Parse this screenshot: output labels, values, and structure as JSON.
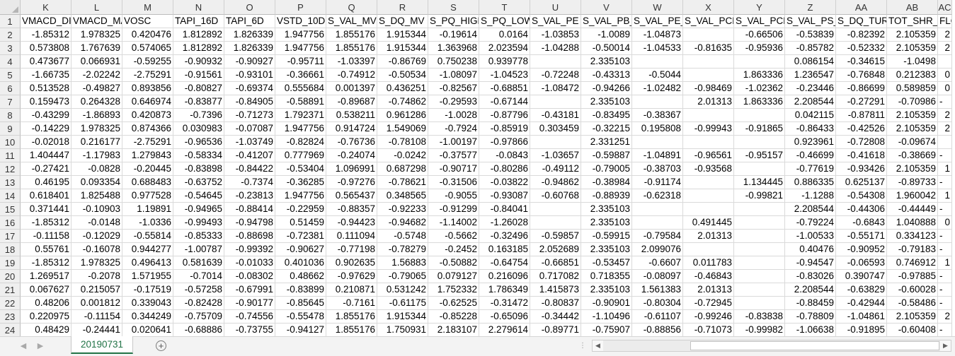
{
  "spreadsheet": {
    "column_letters": [
      "K",
      "L",
      "M",
      "N",
      "O",
      "P",
      "Q",
      "R",
      "S",
      "T",
      "U",
      "V",
      "W",
      "X",
      "Y",
      "Z",
      "AA",
      "AB",
      "AC"
    ],
    "row_numbers": [
      "1",
      "2",
      "3",
      "4",
      "5",
      "6",
      "7",
      "8",
      "9",
      "10",
      "11",
      "12",
      "13",
      "14",
      "15",
      "16",
      "17",
      "18",
      "19",
      "20",
      "21",
      "22",
      "23",
      "24"
    ],
    "rows": [
      [
        "VMACD_DIF",
        "VMACD_MACD",
        "VOSC",
        "TAPI_16D",
        "TAPI_6D",
        "VSTD_10D",
        "S_VAL_MV",
        "S_DQ_MV",
        "S_PQ_HIGH",
        "S_PQ_LOW",
        "S_VAL_PE",
        "S_VAL_PB_",
        "S_VAL_PE_",
        "S_VAL_PCF",
        "S_VAL_PCF",
        "S_VAL_PS_",
        "S_DQ_TUR",
        "TOT_SHR_T",
        "FLOAT"
      ],
      [
        "-1.85312",
        "1.978325",
        "0.420476",
        "1.812892",
        "1.826339",
        "1.947756",
        "1.855176",
        "1.915344",
        "-0.19614",
        "0.0164",
        "-1.03853",
        "-1.0089",
        "-1.04873",
        "",
        "-0.66506",
        "-0.53839",
        "-0.82392",
        "2.105359",
        "2"
      ],
      [
        "0.573808",
        "1.767639",
        "0.574065",
        "1.812892",
        "1.826339",
        "1.947756",
        "1.855176",
        "1.915344",
        "1.363968",
        "2.023594",
        "-1.04288",
        "-0.50014",
        "-1.04533",
        "-0.81635",
        "-0.95936",
        "-0.85782",
        "-0.52332",
        "2.105359",
        "2"
      ],
      [
        "0.473677",
        "0.066931",
        "-0.59255",
        "-0.90932",
        "-0.90927",
        "-0.95711",
        "-1.03397",
        "-0.86769",
        "0.750238",
        "0.939778",
        "",
        "2.335103",
        "",
        "",
        "",
        "0.086154",
        "-0.34615",
        "-1.0498",
        ""
      ],
      [
        "-1.66735",
        "-2.02242",
        "-2.75291",
        "-0.91561",
        "-0.93101",
        "-0.36661",
        "-0.74912",
        "-0.50534",
        "-1.08097",
        "-1.04523",
        "-0.72248",
        "-0.43313",
        "-0.5044",
        "",
        "1.863336",
        "1.236547",
        "-0.76848",
        "0.212383",
        "0"
      ],
      [
        "0.513528",
        "-0.49827",
        "0.893856",
        "-0.80827",
        "-0.69374",
        "0.555684",
        "0.001397",
        "0.436251",
        "-0.82567",
        "-0.68851",
        "-1.08472",
        "-0.94266",
        "-1.02482",
        "-0.98469",
        "-1.02362",
        "-0.23446",
        "-0.86699",
        "0.589859",
        "0"
      ],
      [
        "0.159473",
        "0.264328",
        "0.646974",
        "-0.83877",
        "-0.84905",
        "-0.58891",
        "-0.89687",
        "-0.74862",
        "-0.29593",
        "-0.67144",
        "",
        "2.335103",
        "",
        "2.01313",
        "1.863336",
        "2.208544",
        "-0.27291",
        "-0.70986",
        "-"
      ],
      [
        "-0.43299",
        "-1.86893",
        "0.420873",
        "-0.7396",
        "-0.71273",
        "1.792371",
        "0.538211",
        "0.961286",
        "-1.0028",
        "-0.87796",
        "-0.43181",
        "-0.83495",
        "-0.38367",
        "",
        "",
        "0.042115",
        "-0.87811",
        "2.105359",
        "2"
      ],
      [
        "-0.14229",
        "1.978325",
        "0.874366",
        "0.030983",
        "-0.07087",
        "1.947756",
        "0.914724",
        "1.549069",
        "-0.7924",
        "-0.85919",
        "0.303459",
        "-0.32215",
        "0.195808",
        "-0.99943",
        "-0.91865",
        "-0.86433",
        "-0.42526",
        "2.105359",
        "2"
      ],
      [
        "-0.02018",
        "0.216177",
        "-2.75291",
        "-0.96536",
        "-1.03749",
        "-0.82824",
        "-0.76736",
        "-0.78108",
        "-1.00197",
        "-0.97866",
        "",
        "2.331251",
        "",
        "",
        "",
        "0.923961",
        "-0.72808",
        "-0.09674",
        ""
      ],
      [
        "1.404447",
        "-1.17983",
        "1.279843",
        "-0.58334",
        "-0.41207",
        "0.777969",
        "-0.24074",
        "-0.0242",
        "-0.37577",
        "-0.0843",
        "-1.03657",
        "-0.59887",
        "-1.04891",
        "-0.96561",
        "-0.95157",
        "-0.46699",
        "-0.41618",
        "-0.38669",
        "-"
      ],
      [
        "-0.27421",
        "-0.0828",
        "-0.20445",
        "-0.83898",
        "-0.84422",
        "-0.53404",
        "1.096991",
        "0.687298",
        "-0.90717",
        "-0.80286",
        "-0.49112",
        "-0.79005",
        "-0.38703",
        "-0.93568",
        "",
        "-0.77619",
        "-0.93426",
        "2.105359",
        "1"
      ],
      [
        "0.46195",
        "0.093354",
        "0.688483",
        "-0.63752",
        "-0.7374",
        "-0.36285",
        "-0.97276",
        "-0.78621",
        "-0.31506",
        "-0.03822",
        "-0.94862",
        "-0.38984",
        "-0.91174",
        "",
        "1.134445",
        "0.886335",
        "0.625137",
        "-0.89733",
        "-"
      ],
      [
        "0.618401",
        "1.825488",
        "0.977528",
        "-0.54645",
        "-0.23813",
        "1.947756",
        "0.565437",
        "0.348565",
        "-0.9055",
        "-0.93087",
        "-0.60768",
        "-0.88939",
        "-0.62318",
        "",
        "-0.99821",
        "-1.1288",
        "-0.54308",
        "1.960042",
        "1"
      ],
      [
        "0.371441",
        "-0.10903",
        "1.19891",
        "-0.94965",
        "-0.88414",
        "-0.22959",
        "-0.88357",
        "-0.92233",
        "-0.91299",
        "-0.84041",
        "",
        "2.335103",
        "",
        "",
        "",
        "2.208544",
        "-0.44306",
        "-0.44449",
        "-"
      ],
      [
        "-1.85312",
        "-0.0148",
        "-1.0336",
        "-0.99493",
        "-0.94798",
        "0.51459",
        "-0.94423",
        "-0.94682",
        "-1.14002",
        "-1.26028",
        "",
        "2.335103",
        "",
        "0.491445",
        "",
        "-0.79224",
        "-0.6843",
        "1.040888",
        "0"
      ],
      [
        "-0.11158",
        "-0.12029",
        "-0.55814",
        "-0.85333",
        "-0.88698",
        "-0.72381",
        "0.111094",
        "-0.5748",
        "-0.5662",
        "-0.32496",
        "-0.59857",
        "-0.59915",
        "-0.79584",
        "2.01313",
        "",
        "-1.00533",
        "-0.55171",
        "0.334123",
        "-"
      ],
      [
        "0.55761",
        "-0.16078",
        "0.944277",
        "-1.00787",
        "-0.99392",
        "-0.90627",
        "-0.77198",
        "-0.78279",
        "-0.2452",
        "0.163185",
        "2.052689",
        "2.335103",
        "2.099076",
        "",
        "",
        "0.40476",
        "-0.90952",
        "-0.79183",
        "-"
      ],
      [
        "-1.85312",
        "1.978325",
        "0.496413",
        "0.581639",
        "-0.01033",
        "0.401036",
        "0.902635",
        "1.56883",
        "-0.50882",
        "-0.64754",
        "-0.66851",
        "-0.53457",
        "-0.6607",
        "0.011783",
        "",
        "-0.94547",
        "-0.06593",
        "0.746912",
        "1"
      ],
      [
        "1.269517",
        "-0.2078",
        "1.571955",
        "-0.7014",
        "-0.08302",
        "0.48662",
        "-0.97629",
        "-0.79065",
        "0.079127",
        "0.216096",
        "0.717082",
        "0.718355",
        "-0.08097",
        "-0.46843",
        "",
        "-0.83026",
        "0.390747",
        "-0.97885",
        "-"
      ],
      [
        "0.067627",
        "0.215057",
        "-0.17519",
        "-0.57258",
        "-0.67991",
        "-0.83899",
        "0.210871",
        "0.531242",
        "1.752332",
        "1.786349",
        "1.415873",
        "2.335103",
        "1.561383",
        "2.01313",
        "",
        "2.208544",
        "-0.63829",
        "-0.60028",
        "-"
      ],
      [
        "0.48206",
        "0.001812",
        "0.339043",
        "-0.82428",
        "-0.90177",
        "-0.85645",
        "-0.7161",
        "-0.61175",
        "-0.62525",
        "-0.31472",
        "-0.80837",
        "-0.90901",
        "-0.80304",
        "-0.72945",
        "",
        "-0.88459",
        "-0.42944",
        "-0.58486",
        "-"
      ],
      [
        "0.220975",
        "-0.11154",
        "0.344249",
        "-0.75709",
        "-0.74556",
        "-0.55478",
        "1.855176",
        "1.915344",
        "-0.85228",
        "-0.65096",
        "-0.34442",
        "-1.10496",
        "-0.61107",
        "-0.99246",
        "-0.83838",
        "-0.78809",
        "-1.04861",
        "2.105359",
        "2"
      ],
      [
        "0.48429",
        "-0.24441",
        "0.020641",
        "-0.68886",
        "-0.73755",
        "-0.94127",
        "1.855176",
        "1.750931",
        "2.183107",
        "2.279614",
        "-0.89771",
        "-0.75907",
        "-0.88856",
        "-0.71073",
        "-0.99982",
        "-1.06638",
        "-0.91895",
        "-0.60408",
        "-"
      ]
    ]
  },
  "sheet_tabs": [
    {
      "label": "20190731",
      "active": true
    }
  ],
  "bottom_bar": {
    "prev_icon": "chevron-left-icon",
    "next_icon": "chevron-right-icon",
    "add_icon": "plus-circle-icon",
    "add_symbol": "+",
    "splitter_symbol": "⋮",
    "scroll_left_symbol": "◀",
    "scroll_right_symbol": "▶"
  },
  "colors": {
    "accent": "#217346",
    "header_bg": "#efefef",
    "gridline": "#dadada"
  }
}
